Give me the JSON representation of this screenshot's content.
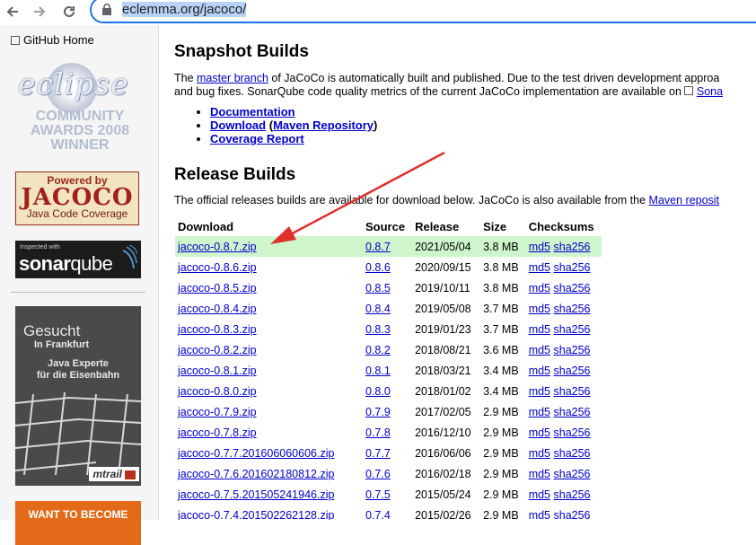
{
  "browser": {
    "back_icon": "arrow-left-icon",
    "forward_icon": "arrow-right-icon",
    "reload_icon": "reload-icon",
    "lock_icon": "lock-icon",
    "url": "eclemma.org/jacoco/"
  },
  "sidebar": {
    "github_link": "GitHub Home",
    "eclipse_logo_text": "eclipse",
    "award_line1": "COMMUNITY",
    "award_line2": "AWARDS 2008",
    "award_line3": "WINNER",
    "powered_line1": "Powered by",
    "powered_line2": "JACOCO",
    "powered_line3": "Java Code Coverage",
    "sonar_small": "Inspected with",
    "sonar_brand_a": "sonar",
    "sonar_brand_b": "qube",
    "ad_title": "Gesucht",
    "ad_location": "In Frankfurt",
    "ad_line1": "Java Experte",
    "ad_line2": "für die Eisenbahn",
    "ad_brand": "mtrail",
    "promo_text": "WANT TO BECOME"
  },
  "snapshot": {
    "heading": "Snapshot Builds",
    "p_line1_a": "The ",
    "p_line1_link": "master branch",
    "p_line1_b": " of JaCoCo is automatically built and published. Due to the test driven development approa",
    "p_line2_a": "and bug fixes. SonarQube code quality metrics of the current JaCoCo implementation are available on ",
    "p_line2_link": "Sona",
    "links": {
      "documentation": "Documentation",
      "download": "Download",
      "open_paren": " (",
      "maven_repo": "Maven Repository",
      "close_paren": ")",
      "coverage": "Coverage Report"
    }
  },
  "release": {
    "heading": "Release Builds",
    "p_a": "The official releases builds are available for download below. JaCoCo is also available from the ",
    "p_link": "Maven reposit",
    "columns": [
      "Download",
      "Source",
      "Release",
      "Size",
      "Checksums"
    ],
    "rows": [
      {
        "file": "jacoco-0.8.7.zip",
        "source": "0.8.7",
        "date": "2021/05/04",
        "size": "3.8 MB",
        "md5": "md5",
        "sha": "sha256"
      },
      {
        "file": "jacoco-0.8.6.zip",
        "source": "0.8.6",
        "date": "2020/09/15",
        "size": "3.8 MB",
        "md5": "md5",
        "sha": "sha256"
      },
      {
        "file": "jacoco-0.8.5.zip",
        "source": "0.8.5",
        "date": "2019/10/11",
        "size": "3.8 MB",
        "md5": "md5",
        "sha": "sha256"
      },
      {
        "file": "jacoco-0.8.4.zip",
        "source": "0.8.4",
        "date": "2019/05/08",
        "size": "3.7 MB",
        "md5": "md5",
        "sha": "sha256"
      },
      {
        "file": "jacoco-0.8.3.zip",
        "source": "0.8.3",
        "date": "2019/01/23",
        "size": "3.7 MB",
        "md5": "md5",
        "sha": "sha256"
      },
      {
        "file": "jacoco-0.8.2.zip",
        "source": "0.8.2",
        "date": "2018/08/21",
        "size": "3.6 MB",
        "md5": "md5",
        "sha": "sha256"
      },
      {
        "file": "jacoco-0.8.1.zip",
        "source": "0.8.1",
        "date": "2018/03/21",
        "size": "3.4 MB",
        "md5": "md5",
        "sha": "sha256"
      },
      {
        "file": "jacoco-0.8.0.zip",
        "source": "0.8.0",
        "date": "2018/01/02",
        "size": "3.4 MB",
        "md5": "md5",
        "sha": "sha256"
      },
      {
        "file": "jacoco-0.7.9.zip",
        "source": "0.7.9",
        "date": "2017/02/05",
        "size": "2.9 MB",
        "md5": "md5",
        "sha": "sha256"
      },
      {
        "file": "jacoco-0.7.8.zip",
        "source": "0.7.8",
        "date": "2016/12/10",
        "size": "2.9 MB",
        "md5": "md5",
        "sha": "sha256"
      },
      {
        "file": "jacoco-0.7.7.201606060606.zip",
        "source": "0.7.7",
        "date": "2016/06/06",
        "size": "2.9 MB",
        "md5": "md5",
        "sha": "sha256"
      },
      {
        "file": "jacoco-0.7.6.201602180812.zip",
        "source": "0.7.6",
        "date": "2016/02/18",
        "size": "2.9 MB",
        "md5": "md5",
        "sha": "sha256"
      },
      {
        "file": "jacoco-0.7.5.201505241946.zip",
        "source": "0.7.5",
        "date": "2015/05/24",
        "size": "2.9 MB",
        "md5": "md5",
        "sha": "sha256"
      },
      {
        "file": "jacoco-0.7.4.201502262128.zip",
        "source": "0.7.4",
        "date": "2015/02/26",
        "size": "2.9 MB",
        "md5": "md5",
        "sha": "sha256"
      }
    ],
    "highlight_color": "#cff5cc"
  },
  "annotation": {
    "arrow_color": "#e0302a",
    "arrow_icon": "red-arrow-annotation"
  },
  "colors": {
    "link": "#0000cc",
    "url_focus": "#1a73e8"
  }
}
